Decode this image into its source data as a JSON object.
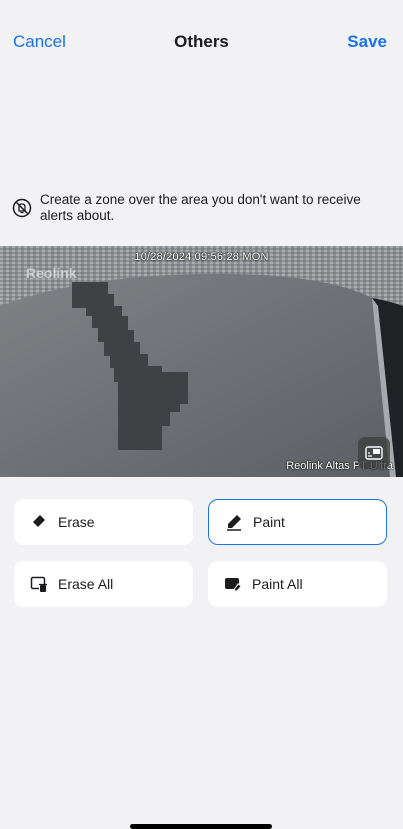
{
  "nav": {
    "cancel_label": "Cancel",
    "title": "Others",
    "save_label": "Save"
  },
  "hint": {
    "icon": "no-alert-icon",
    "text": "Create a zone over the area you don't want to receive alerts about."
  },
  "camera": {
    "timestamp": "10/28/2024 09:56:28 MON",
    "brand_watermark": "Reolink",
    "camera_name": "Reolink Altas PT Ultra",
    "switch_icon": "switch-view-icon"
  },
  "tools": {
    "erase_label": "Erase",
    "paint_label": "Paint",
    "erase_all_label": "Erase All",
    "paint_all_label": "Paint All",
    "selected": "Paint"
  },
  "colors": {
    "accent": "#1a73e8",
    "mask": "#3f4144"
  }
}
